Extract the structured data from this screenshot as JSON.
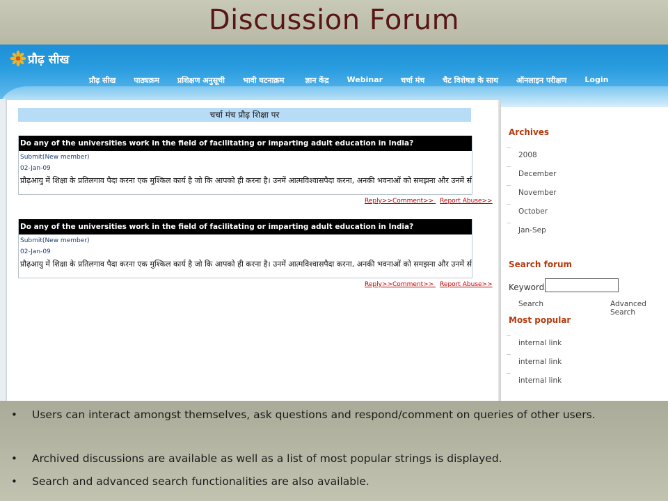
{
  "slide": {
    "title": "Discussion Forum"
  },
  "site": {
    "logo_text": "प्रौढ़ सीख",
    "nav": [
      "प्रौढ़ सीख",
      "पाठ्यक्रम",
      "प्रशिक्षण अनुसूची",
      "भावी घटनाक्रम",
      "ज्ञान केंद्र",
      "Webinar",
      "चर्चा मंच",
      "चैट विशेषज्ञ के साथ",
      "ऑनलाइन परीक्षण",
      "Login"
    ],
    "accent_color": "#1c8fd6"
  },
  "forum": {
    "banner": "चर्चा मंच प्रौढ़ शिक्षा पर",
    "posts": [
      {
        "question": "Do any of the universities work in the field of facilitating or imparting adult education in India?",
        "submitter": "Submit(New member)",
        "date": "02-Jan-09",
        "body": "प्रौढ़आयु में शिक्षा के प्रतिलगाव पैदा करना एक मुश्किल कार्य है जो कि आपको ही करना है। उनमें आत्मविश्वासपैदा करना, अनकी भवनाओं को समझना और उनमें सीखने कि",
        "reply_link": "Reply>>Comment>>",
        "report_link": "Report Abuse>>"
      },
      {
        "question": "Do any of the universities work in the field of facilitating or imparting adult education in India?",
        "submitter": "Submit(New member)",
        "date": "02-Jan-09",
        "body": "प्रौढ़आयु में शिक्षा के प्रतिलगाव पैदा करना एक मुश्किल कार्य है जो कि आपको ही करना है। उनमें आत्मविश्वासपैदा करना, अनकी भवनाओं को समझना और उनमें सीखने कि",
        "reply_link": "Reply>>Comment>>",
        "report_link": "Report Abuse>>"
      }
    ]
  },
  "sidebar": {
    "archives_heading": "Archives",
    "archives": [
      "2008",
      "December",
      "November",
      "October",
      "Jan-Sep"
    ],
    "search_heading": "Search forum",
    "keywords_label": "Keywords",
    "keywords_value": "",
    "search_link": "Search",
    "advanced_search_link": "Advanced Search",
    "popular_heading": "Most popular",
    "popular": [
      "internal link",
      "internal link",
      "internal link"
    ]
  },
  "bullets": [
    "Users can interact amongst themselves, ask questions and respond/comment on queries of other users.",
    "Archived discussions are available as well as a list of most popular strings is displayed.",
    "Search and advanced search functionalities are also available."
  ]
}
